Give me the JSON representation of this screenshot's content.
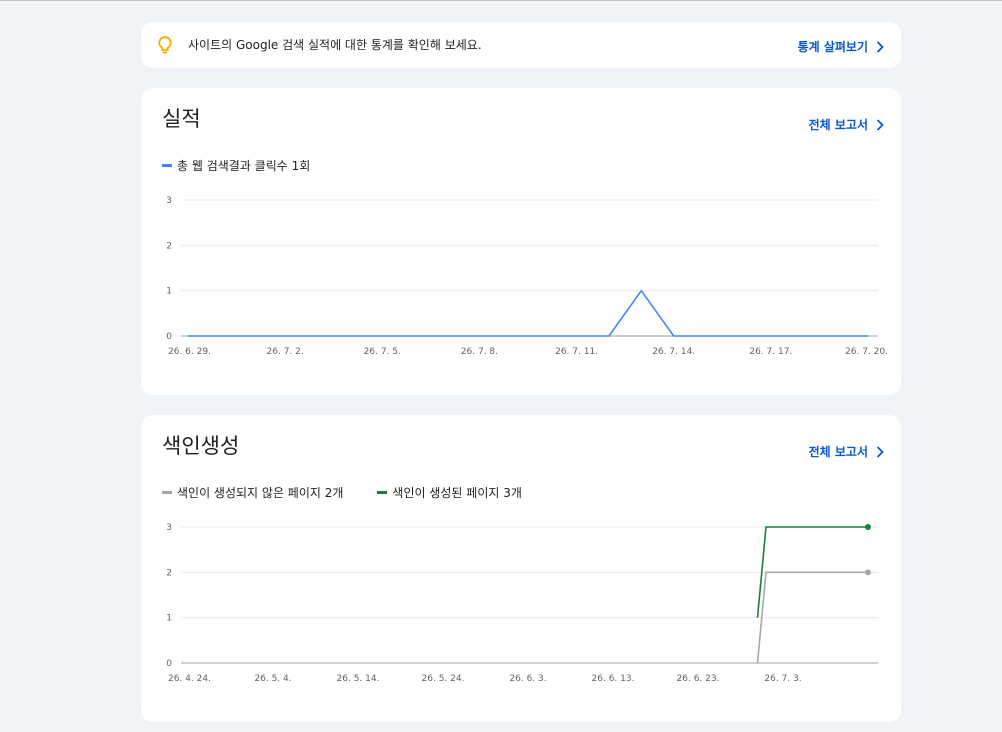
{
  "tip": {
    "text": "사이트의 Google 검색 실적에 대한 통계를 확인해 보세요.",
    "link_label": "통계 살펴보기",
    "icon": "lightbulb-icon",
    "icon_color": "#f9ab00"
  },
  "performance": {
    "title": "실적",
    "link_label": "전체 보고서",
    "legend_label": "총 웹 검색결과 클릭수 1회"
  },
  "indexing": {
    "title": "색인생성",
    "link_label": "전체 보고서",
    "legend": [
      {
        "label": "색인이 생성되지 않은 페이지 2개",
        "color": "#a8a8a8"
      },
      {
        "label": "색인이 생성된 페이지 3개",
        "color": "#188038"
      }
    ]
  },
  "colors": {
    "accent": "#0b57d0",
    "clicks_series": "#4285f4",
    "not_indexed_series": "#a8a8a8",
    "indexed_series": "#188038",
    "page_background": "#f0f4f9"
  },
  "chart_data": [
    {
      "type": "line",
      "x": [
        "26. 6. 29.",
        "26. 6. 30.",
        "26. 7. 1.",
        "26. 7. 2.",
        "26. 7. 3.",
        "26. 7. 4.",
        "26. 7. 5.",
        "26. 7. 6.",
        "26. 7. 7.",
        "26. 7. 8.",
        "26. 7. 9.",
        "26. 7. 10.",
        "26. 7. 11.",
        "26. 7. 12.",
        "26. 7. 13.",
        "26. 7. 14.",
        "26. 7. 15.",
        "26. 7. 16.",
        "26. 7. 17.",
        "26. 7. 18.",
        "26. 7. 19.",
        "26. 7. 20."
      ],
      "tick_labels": [
        "26. 6. 29.",
        "26. 7. 2.",
        "26. 7. 5.",
        "26. 7. 8.",
        "26. 7. 11.",
        "26. 7. 14.",
        "26. 7. 17.",
        "26. 7. 20."
      ],
      "series": [
        {
          "name": "총 웹 검색결과 클릭수 1회",
          "color": "#4285f4",
          "values": [
            0,
            0,
            0,
            0,
            0,
            0,
            0,
            0,
            0,
            0,
            0,
            0,
            0,
            0,
            1,
            0,
            0,
            0,
            0,
            0,
            0,
            0
          ]
        }
      ],
      "ylim": [
        0,
        3
      ],
      "yticks": [
        0,
        1,
        2,
        3
      ],
      "grid": true,
      "legend": "top-left"
    },
    {
      "type": "line",
      "x_range": [
        "26. 4. 24.",
        "26. 7. 13."
      ],
      "tick_labels": [
        "26. 4. 24.",
        "26. 5. 4.",
        "26. 5. 14.",
        "26. 5. 24.",
        "26. 6. 3.",
        "26. 6. 13.",
        "26. 6. 23.",
        "26. 7. 3."
      ],
      "series": [
        {
          "name": "색인이 생성되지 않은 페이지 2개",
          "color": "#a8a8a8",
          "points": [
            [
              "26. 6. 30.",
              0
            ],
            [
              "26. 7. 1.",
              2
            ],
            [
              "26. 7. 13.",
              2
            ]
          ],
          "end_marker": true
        },
        {
          "name": "색인이 생성된 페이지 3개",
          "color": "#188038",
          "points": [
            [
              "26. 6. 30.",
              1
            ],
            [
              "26. 7. 1.",
              3
            ],
            [
              "26. 7. 13.",
              3
            ]
          ],
          "end_marker": true
        }
      ],
      "ylim": [
        0,
        3
      ],
      "yticks": [
        0,
        1,
        2,
        3
      ],
      "grid": true,
      "legend": "top-left"
    }
  ]
}
